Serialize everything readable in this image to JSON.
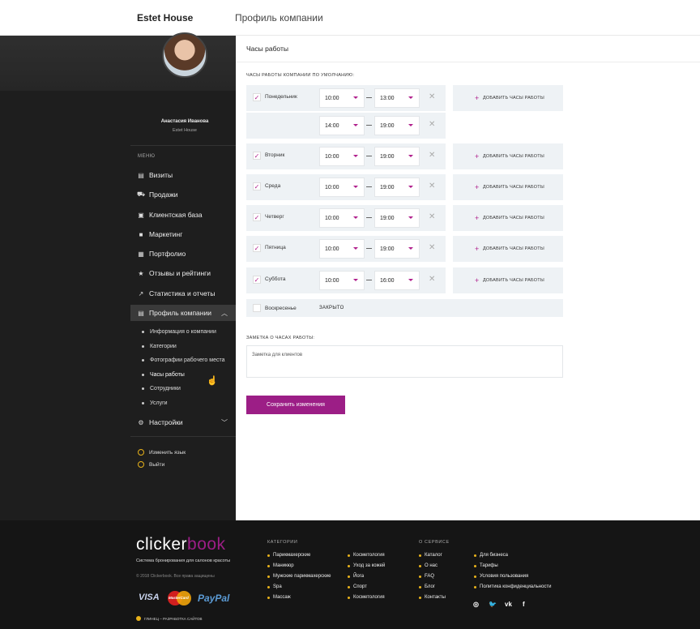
{
  "header": {
    "brand": "Estet House",
    "title": "Профиль компании"
  },
  "sidebar": {
    "user_name": "Анастасия Иванова",
    "user_company": "Estet House",
    "menu_heading": "МЕНЮ",
    "items": [
      {
        "label": "Визиты",
        "icon": "calendar-icon"
      },
      {
        "label": "Продажи",
        "icon": "cart-icon"
      },
      {
        "label": "Клиентская база",
        "icon": "contacts-icon"
      },
      {
        "label": "Маркетинг",
        "icon": "briefcase-icon"
      },
      {
        "label": "Портфолио",
        "icon": "portfolio-icon"
      },
      {
        "label": "Отзывы и рейтинги",
        "icon": "star-icon"
      },
      {
        "label": "Статистика и отчеты",
        "icon": "trend-icon"
      },
      {
        "label": "Профиль компании",
        "icon": "profile-icon"
      },
      {
        "label": "Настройки",
        "icon": "gear-icon"
      }
    ],
    "subitems": [
      "Информация о компании",
      "Категории",
      "Фотографии рабочего места",
      "Часы работы",
      "Сотрудники",
      "Услуги"
    ],
    "change_language": "Изменить язык",
    "logout": "Выйти"
  },
  "main": {
    "title": "Часы работы",
    "hours_label": "ЧАСЫ РАБОТЫ КОМПАНИИ ПО УМОЛЧАНИЮ:",
    "add_hours_label": "ДОБАВИТЬ ЧАСЫ РАБОТЫ",
    "days": [
      {
        "name": "Понедельник",
        "checked": true,
        "from": "10:00",
        "to": "13:00"
      },
      {
        "name": "",
        "checked": false,
        "from": "14:00",
        "to": "19:00"
      },
      {
        "name": "Вторник",
        "checked": true,
        "from": "10:00",
        "to": "19:00"
      },
      {
        "name": "Среда",
        "checked": true,
        "from": "10:00",
        "to": "19:00"
      },
      {
        "name": "Четверг",
        "checked": true,
        "from": "10:00",
        "to": "19:00"
      },
      {
        "name": "Пятница",
        "checked": true,
        "from": "10:00",
        "to": "19:00"
      },
      {
        "name": "Суббота",
        "checked": true,
        "from": "10:00",
        "to": "16:00"
      }
    ],
    "sunday": {
      "name": "Воскресенье",
      "status": "ЗАКРЫТО"
    },
    "note_label": "ЗАМЕТКА О ЧАСАХ РАБОТЫ:",
    "note_placeholder": "Заметка для клиентов",
    "save_label": "Сохранить изменения"
  },
  "footer": {
    "logo_main": "clicker",
    "logo_accent": "book",
    "tagline": "Система бронирования для салонов красоты",
    "copyright": "© 2018 Clickerbook. Все права защищены",
    "payment": {
      "visa": "VISA",
      "mastercard": "MasterCard",
      "paypal": "PayPal"
    },
    "dev_credit": "ГЛИНЕЦ – РАЗРАБОТКА САЙТОВ",
    "categories_heading": "КАТЕГОРИИ",
    "categories_col1": [
      "Парикмахерские",
      "Маникюр",
      "Мужские парикмахерские",
      "Spa",
      "Массаж"
    ],
    "categories_col2": [
      "Косметология",
      "Уход за кожей",
      "Йога",
      "Спорт",
      "Косметология"
    ],
    "about_heading": "О СЕРВИСЕ",
    "about_col1": [
      "Каталог",
      "О нас",
      "FAQ",
      "Блог",
      "Контакты"
    ],
    "about_col2": [
      "Для бизнеса",
      "Тарифы",
      "Условия пользования",
      "Политика конфиденциальности"
    ],
    "social": [
      "instagram-icon",
      "twitter-icon",
      "vk-icon",
      "facebook-icon"
    ]
  },
  "colors": {
    "accent": "#9c1e86",
    "sidebar_bg": "#1e1e1e",
    "row_bg": "#eef2f5",
    "footer_bg": "#151515",
    "footer_dot": "#e8b21a"
  }
}
